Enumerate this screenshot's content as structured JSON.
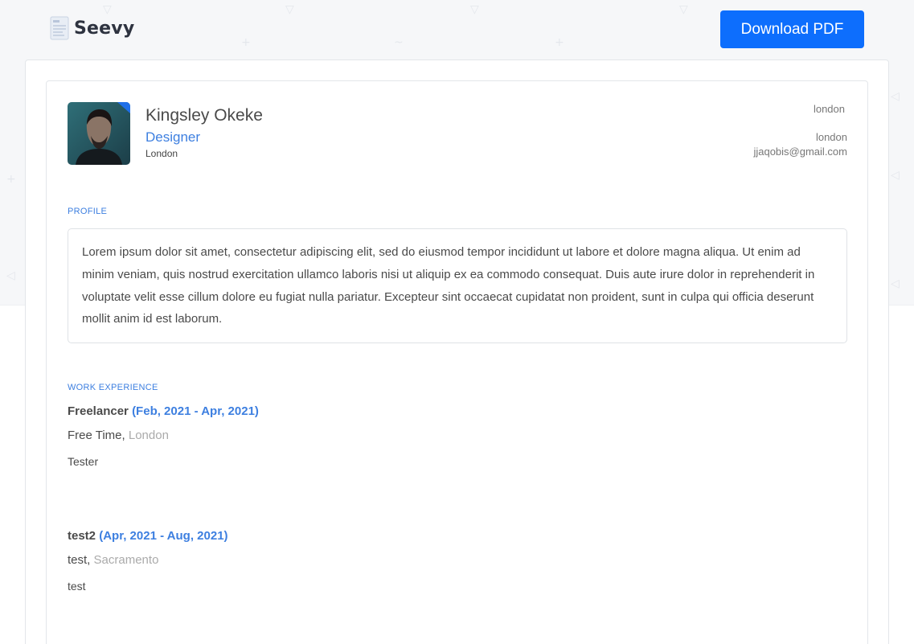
{
  "header": {
    "app_name": "Seevy",
    "download_label": "Download PDF"
  },
  "colors": {
    "accent": "#0d6efd",
    "link_blue": "#3d7fe0",
    "muted": "#aaaaaa"
  },
  "resume": {
    "name": "Kingsley Okeke",
    "role": "Designer",
    "city": "London",
    "contact": {
      "address": "london",
      "city": "london",
      "email": "jjaqobis@gmail.com"
    },
    "profile": {
      "title": "PROFILE",
      "text": "Lorem ipsum dolor sit amet, consectetur adipiscing elit, sed do eiusmod tempor incididunt ut labore et dolore magna aliqua. Ut enim ad minim veniam, quis nostrud exercitation ullamco laboris nisi ut aliquip ex ea commodo consequat. Duis aute irure dolor in reprehenderit in voluptate velit esse cillum dolore eu fugiat nulla pariatur. Excepteur sint occaecat cupidatat non proident, sunt in culpa qui officia deserunt mollit anim id est laborum."
    },
    "work": {
      "title": "WORK EXPERIENCE",
      "jobs": [
        {
          "title": "Freelancer",
          "dates": "(Feb, 2021 - Apr, 2021)",
          "company": "Free Time,",
          "location": "London",
          "description": "Tester"
        },
        {
          "title": "test2",
          "dates": "(Apr, 2021 - Aug, 2021)",
          "company": "test,",
          "location": "Sacramento",
          "description": "test"
        }
      ]
    }
  }
}
